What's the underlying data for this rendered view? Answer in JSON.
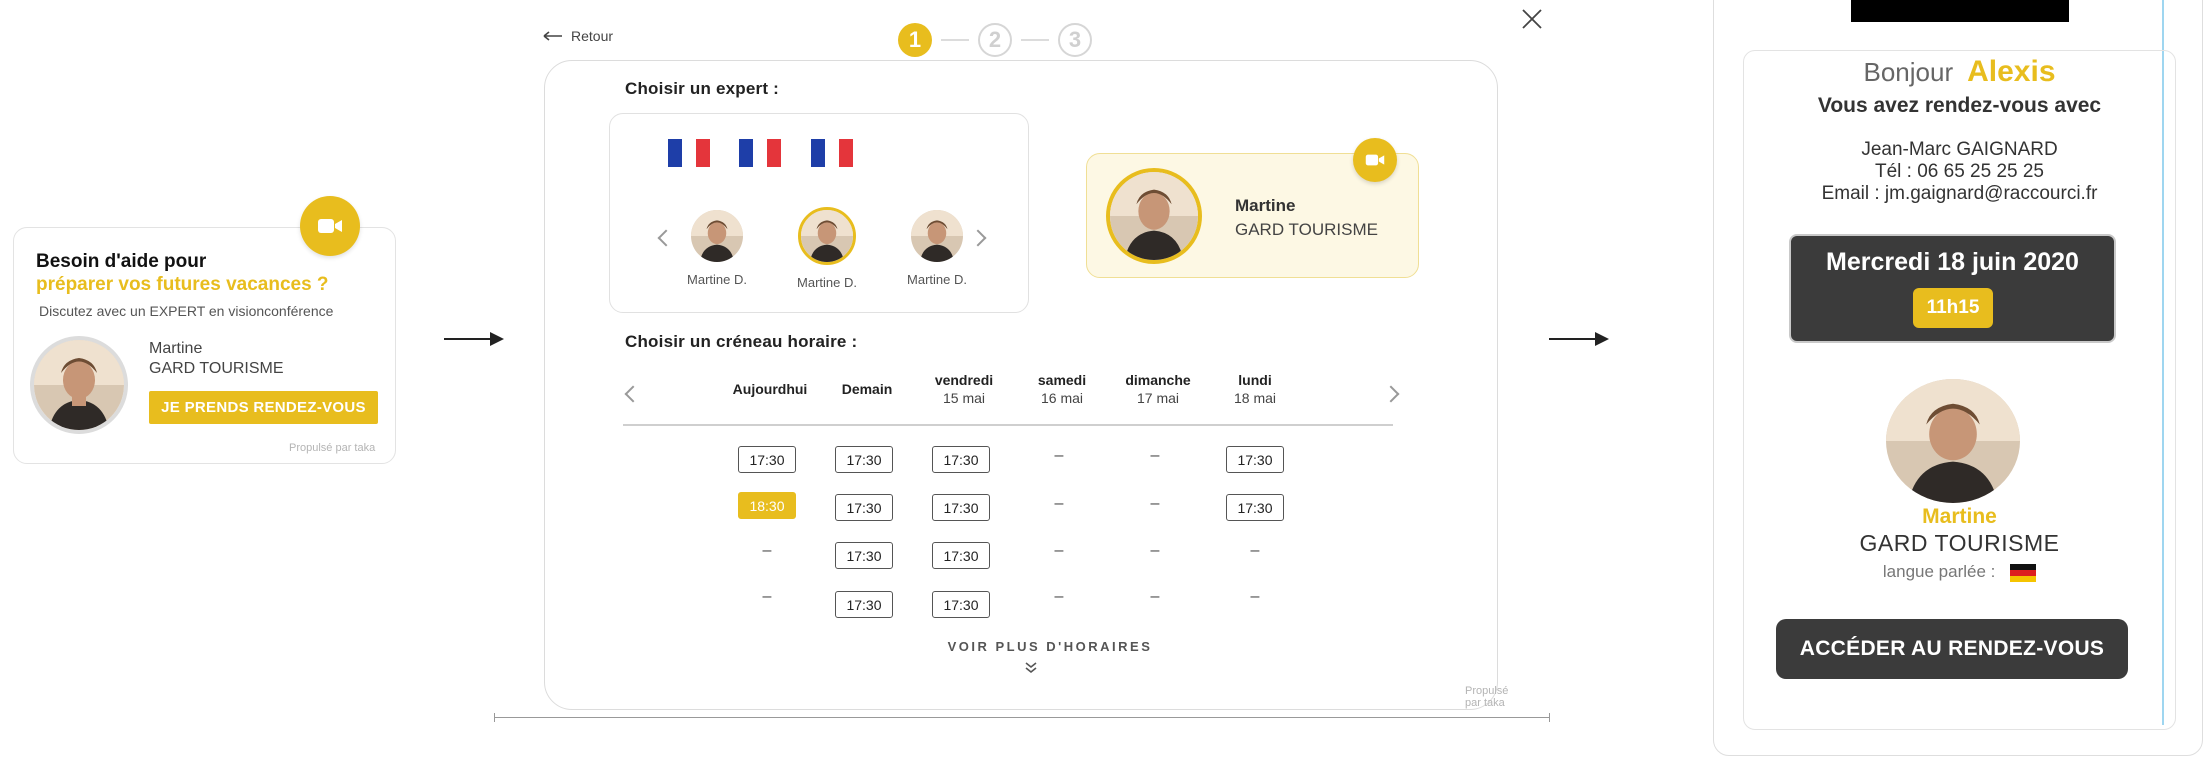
{
  "widget": {
    "title_line1": "Besoin d'aide pour",
    "title_line2": "préparer vos futures vacances ?",
    "subtitle": "Discutez avec un EXPERT en visionconférence",
    "expert_name": "Martine",
    "expert_org": "GARD TOURISME",
    "cta_label": "JE PRENDS RENDEZ-VOUS",
    "powered_by": "Propulsé par taka",
    "camera_icon": "video-camera-icon"
  },
  "booking": {
    "back_label": "Retour",
    "steps": [
      "1",
      "2",
      "3"
    ],
    "active_step": 1,
    "expert_section_title": "Choisir un expert :",
    "experts": [
      {
        "label": "Martine D.",
        "flag": "fr",
        "selected": false
      },
      {
        "label": "Martine D.",
        "flag": "fr",
        "selected": true
      },
      {
        "label": "Martine D.",
        "flag": "fr",
        "selected": false
      }
    ],
    "selected_expert": {
      "name": "Martine",
      "org": "GARD TOURISME"
    },
    "slot_section_title": "Choisir un créneau horaire :",
    "days": [
      {
        "name": "Aujourdhui",
        "date": ""
      },
      {
        "name": "Demain",
        "date": ""
      },
      {
        "name": "vendredi",
        "date": "15 mai"
      },
      {
        "name": "samedi",
        "date": "16 mai"
      },
      {
        "name": "dimanche",
        "date": "17 mai"
      },
      {
        "name": "lundi",
        "date": "18 mai"
      }
    ],
    "slots": [
      [
        "17:30",
        "17:30",
        "17:30",
        "–",
        "–",
        "17:30"
      ],
      [
        "18:30",
        "17:30",
        "17:30",
        "–",
        "–",
        "17:30"
      ],
      [
        "–",
        "17:30",
        "17:30",
        "–",
        "–",
        "–"
      ],
      [
        "–",
        "17:30",
        "17:30",
        "–",
        "–",
        "–"
      ]
    ],
    "selected_slot": {
      "row": 1,
      "col": 0
    },
    "more_label": "VOIR PLUS D'HORAIRES",
    "powered_by": "Propulsé par taka"
  },
  "confirmation": {
    "greeting": "Bonjour",
    "user_name": "Alexis",
    "rdv_text": "Vous avez rendez-vous avec",
    "contact_name": "Jean-Marc GAIGNARD",
    "contact_phone": "Tél : 06 65 25 25 25",
    "contact_email": "Email : jm.gaignard@raccourci.fr",
    "date": "Mercredi 18 juin 2020",
    "time": "11h15",
    "expert_name": "Martine",
    "expert_org": "GARD TOURISME",
    "language_label": "langue parlée :",
    "language_flag": "de",
    "cta_label": "ACCÉDER AU RENDEZ-VOUS"
  },
  "colors": {
    "accent": "#e8bd1e",
    "dark": "#3b3b3b",
    "flag_fr_blue": "#1e3ea8",
    "flag_fr_red": "#e4353b"
  }
}
